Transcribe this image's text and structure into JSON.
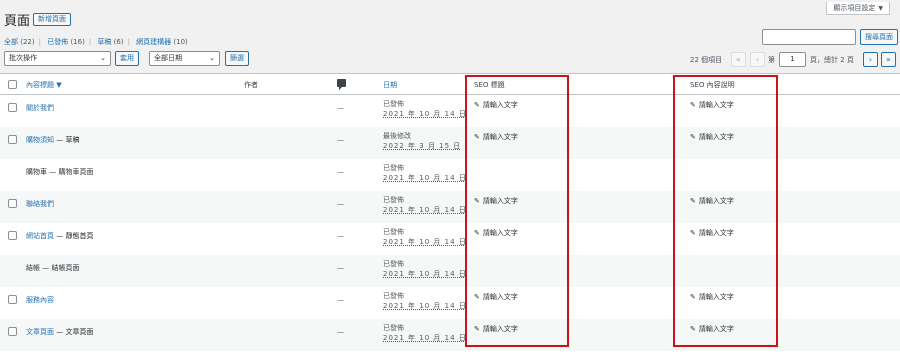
{
  "header": {
    "screen_options": "顯示項目設定",
    "title": "頁面",
    "add_new": "新增頁面"
  },
  "filters": {
    "all": "全部",
    "all_count": "(22)",
    "published": "已發佈",
    "published_count": "(16)",
    "draft": "草稿",
    "draft_count": "(6)",
    "builder": "網頁建構器",
    "builder_count": "(10)"
  },
  "search": {
    "value": "",
    "button": "搜尋頁面"
  },
  "toolbar": {
    "bulk_actions": "批次操作",
    "apply": "套用",
    "date_filter": "全部日期",
    "filter": "篩選"
  },
  "pagination": {
    "items": "22 個項目",
    "first": "«",
    "prev": "‹",
    "page_prefix": "第",
    "current_page": "1",
    "page_suffix": "頁，總計 2 頁",
    "next": "›",
    "last": "»"
  },
  "columns": {
    "title": "內容標題 ▼",
    "author": "作者",
    "date": "日期",
    "seo_title": "SEO 標題",
    "seo_desc": "SEO 內容說明"
  },
  "rows": [
    {
      "title": "關於我們",
      "state": "",
      "author": "—",
      "status": "已發佈",
      "date": "2021 年 10 月 14 日",
      "seo_title": "請輸入文字",
      "seo_desc": "請輸入文字"
    },
    {
      "title": "購物須知",
      "state": " — 草稿",
      "author": "—",
      "status": "最後修改",
      "date": "2022 年 3 月 15 日",
      "seo_title": "請輸入文字",
      "seo_desc": "請輸入文字"
    },
    {
      "title": "購物車 — 購物車頁面",
      "state": "",
      "author": "—",
      "status": "已發佈",
      "date": "2021 年 10 月 14 日",
      "seo_title": "",
      "seo_desc": ""
    },
    {
      "title": "聯絡我們",
      "state": "",
      "author": "—",
      "status": "已發佈",
      "date": "2021 年 10 月 14 日",
      "seo_title": "請輸入文字",
      "seo_desc": "請輸入文字"
    },
    {
      "title": "網站首頁",
      "state": " — 靜態首頁",
      "author": "—",
      "status": "已發佈",
      "date": "2021 年 10 月 14 日",
      "seo_title": "請輸入文字",
      "seo_desc": "請輸入文字"
    },
    {
      "title": "結帳 — 結帳頁面",
      "state": "",
      "author": "—",
      "status": "已發佈",
      "date": "2021 年 10 月 14 日",
      "seo_title": "",
      "seo_desc": ""
    },
    {
      "title": "服務內容",
      "state": "",
      "author": "—",
      "status": "已發佈",
      "date": "2021 年 10 月 14 日",
      "seo_title": "請輸入文字",
      "seo_desc": "請輸入文字"
    },
    {
      "title": "文章頁面",
      "state": " — 文章頁面",
      "author": "—",
      "status": "已發佈",
      "date": "2021 年 10 月 14 日",
      "seo_title": "請輸入文字",
      "seo_desc": "請輸入文字"
    }
  ],
  "icons": {
    "pencil": "pencil-icon",
    "comment": "comment-bubble-icon"
  },
  "colors": {
    "accent": "#2271b1",
    "highlight_box": "#c7151a"
  }
}
